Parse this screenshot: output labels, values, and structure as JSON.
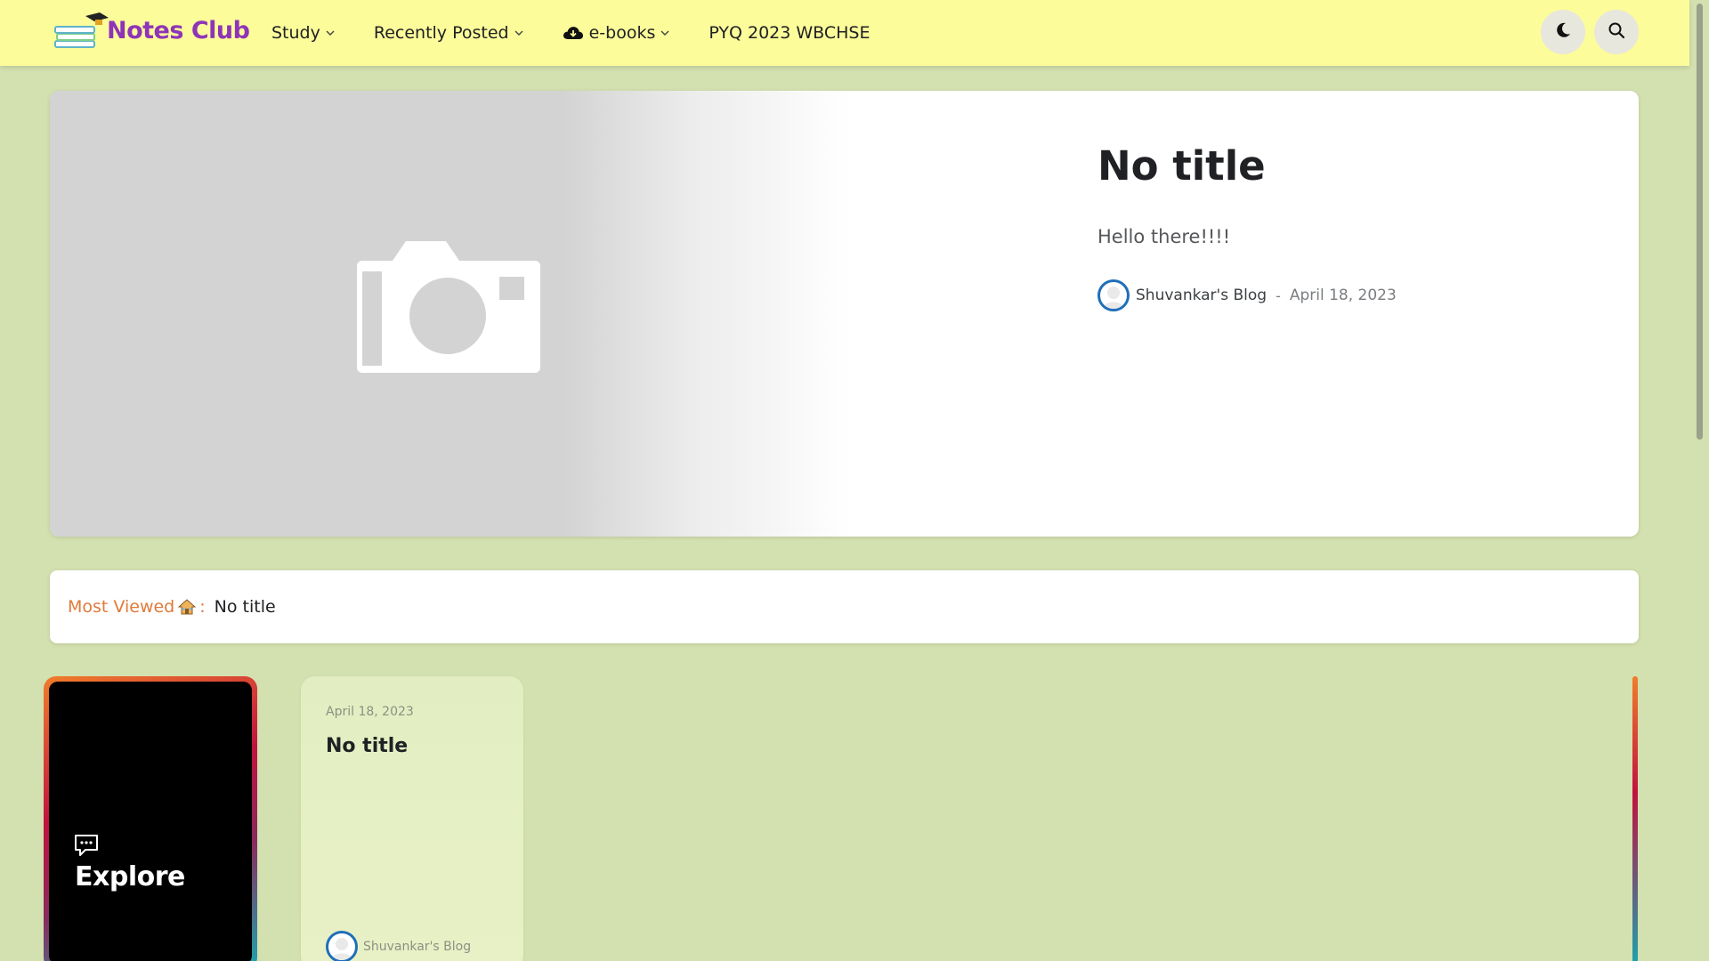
{
  "header": {
    "logo_text": "Notes Club",
    "nav": [
      {
        "label": "Study",
        "dropdown": true
      },
      {
        "label": "Recently Posted",
        "dropdown": true
      },
      {
        "label": "e-books",
        "dropdown": true,
        "icon": "cloud-download-icon"
      },
      {
        "label": "PYQ 2023 WBCHSE",
        "dropdown": false
      }
    ],
    "buttons": {
      "dark_mode_icon": "moon-icon",
      "search_icon": "search-icon"
    }
  },
  "hero": {
    "title": "No title",
    "snippet": "Hello there!!!!",
    "author": "Shuvankar's Blog",
    "separator": "-",
    "date": "April 18, 2023",
    "image_icon": "camera-icon"
  },
  "most_viewed": {
    "label": "Most Viewed",
    "emoji_icon": "house-emoji-icon",
    "colon": ":",
    "value": "No title"
  },
  "explore": {
    "label": "Explore",
    "icon": "chat-bubble-icon"
  },
  "post_card": {
    "date": "April 18, 2023",
    "title": "No title",
    "author": "Shuvankar's Blog"
  },
  "colors": {
    "page_bg": "#d3e0af",
    "header_bg": "#fcfc9a",
    "logo": "#8e34b8",
    "accent_orange": "#e07a3a",
    "avatar_ring": "#1f6fb9"
  }
}
